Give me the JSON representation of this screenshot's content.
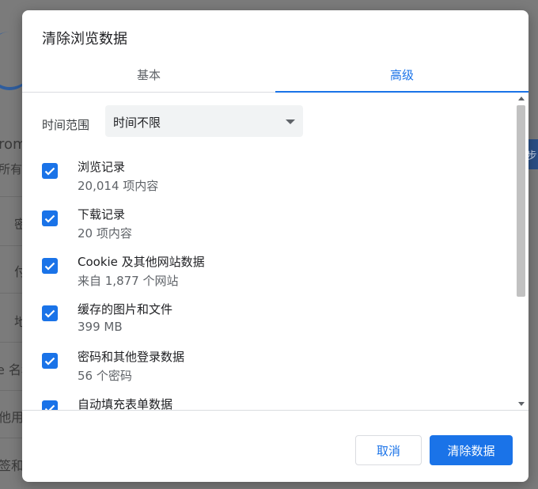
{
  "background": {
    "fragments": [
      "rom",
      "所有",
      "密",
      "付",
      "地",
      "e 名称",
      "他用",
      "签和"
    ],
    "side_button_label": "步"
  },
  "dialog": {
    "title": "清除浏览数据",
    "tabs": [
      {
        "label": "基本",
        "active": false
      },
      {
        "label": "高级",
        "active": true
      }
    ],
    "time_range": {
      "label": "时间范围",
      "value": "时间不限"
    },
    "items": [
      {
        "title": "浏览记录",
        "subtitle": "20,014 项内容",
        "checked": true
      },
      {
        "title": "下载记录",
        "subtitle": "20 项内容",
        "checked": true
      },
      {
        "title": "Cookie 及其他网站数据",
        "subtitle": "来自 1,877 个网站",
        "checked": true
      },
      {
        "title": "缓存的图片和文件",
        "subtitle": "399 MB",
        "checked": true
      },
      {
        "title": "密码和其他登录数据",
        "subtitle": "56 个密码",
        "checked": true
      },
      {
        "title": "自动填充表单数据",
        "subtitle": "",
        "checked": true
      }
    ],
    "buttons": {
      "cancel": "取消",
      "clear": "清除数据"
    }
  },
  "colors": {
    "accent": "#1a73e8",
    "overlay": "#7b7b7b"
  }
}
